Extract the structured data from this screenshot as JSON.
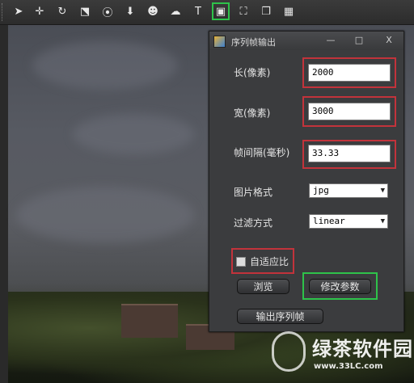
{
  "toolbar": {
    "buttons": [
      {
        "name": "select-arrow-icon",
        "glyph": "➤"
      },
      {
        "name": "move-icon",
        "glyph": "✛"
      },
      {
        "name": "rotate-icon",
        "glyph": "↻"
      },
      {
        "name": "scale-icon",
        "glyph": "⬔"
      },
      {
        "name": "compass-icon",
        "glyph": "⦿"
      },
      {
        "name": "download-icon",
        "glyph": "⬇"
      },
      {
        "name": "person-icon",
        "glyph": "☻"
      },
      {
        "name": "weather-icon",
        "glyph": "☁"
      },
      {
        "name": "text-icon",
        "glyph": "T"
      },
      {
        "name": "frame-output-icon",
        "glyph": "▣"
      },
      {
        "name": "fullscreen-icon",
        "glyph": "⛶"
      },
      {
        "name": "window-icon",
        "glyph": "❐"
      },
      {
        "name": "palette-icon",
        "glyph": "▦"
      }
    ],
    "active_index": 9
  },
  "dialog": {
    "title": "序列帧输出",
    "minimize_glyph": "—",
    "maximize_glyph": "□",
    "close_glyph": "X",
    "fields": {
      "width_label": "长(像素)",
      "width_value": "2000",
      "height_label": "宽(像素)",
      "height_value": "3000",
      "interval_label": "帧间隔(毫秒)",
      "interval_value": "33.33"
    },
    "format_label": "图片格式",
    "format_value": "jpg",
    "filter_label": "过滤方式",
    "filter_value": "linear",
    "adaptive_label": "自适应比",
    "adaptive_checked": false,
    "browse_label": "浏览",
    "modify_label": "修改参数",
    "output_label": "输出序列帧"
  },
  "watermark": {
    "text": "绿茶软件园",
    "url": "www.33LC.com"
  },
  "colors": {
    "highlight_red": "#c2333b",
    "highlight_green": "#2ec24a"
  }
}
